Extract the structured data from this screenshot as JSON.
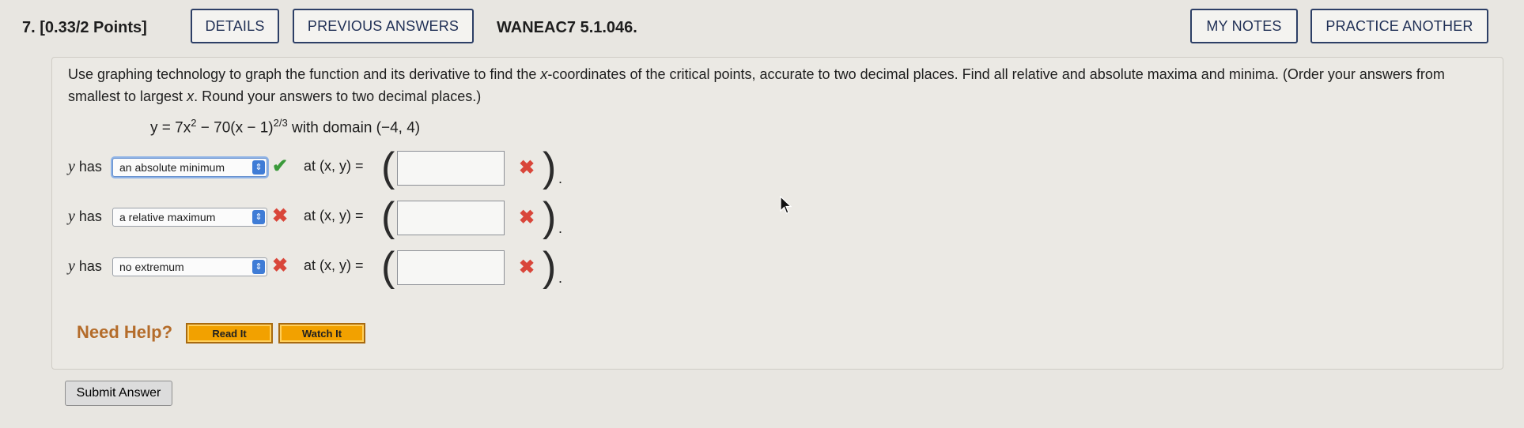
{
  "header": {
    "question_number": "7. [0.33/2 Points]",
    "details_label": "DETAILS",
    "previous_answers_label": "PREVIOUS ANSWERS",
    "question_id": "WANEAC7 5.1.046.",
    "my_notes_label": "MY NOTES",
    "practice_another_label": "PRACTICE ANOTHER"
  },
  "question": {
    "instructions_part1": "Use graphing technology to graph the function and its derivative to find the ",
    "instructions_x1": "x",
    "instructions_part2": "-coordinates of the critical points, accurate to two decimal places. Find all relative and absolute maxima and minima. (Order your answers from smallest to largest ",
    "instructions_x2": "x",
    "instructions_part3": ". Round your answers to two decimal places.)",
    "formula": {
      "lhs": "y = 7x",
      "exp1": "2",
      "mid": " − 70(x − 1)",
      "exp2": "2/3",
      "rest": " with domain (−4, 4)"
    }
  },
  "rows": [
    {
      "prefix": "has",
      "selected": "an absolute minimum",
      "status": "correct",
      "at_label": "at (x, y) =",
      "answer": ""
    },
    {
      "prefix": "has",
      "selected": "a relative maximum",
      "status": "incorrect",
      "at_label": "at (x, y) =",
      "answer": ""
    },
    {
      "prefix": "has",
      "selected": "no extremum",
      "status": "incorrect",
      "at_label": "at (x, y) =",
      "answer": ""
    }
  ],
  "icons": {
    "correct": "✔",
    "incorrect": "✖",
    "select_arrow": "⇕"
  },
  "help": {
    "title": "Need Help?",
    "read_it": "Read It",
    "watch_it": "Watch It"
  },
  "submit_label": "Submit Answer",
  "colors": {
    "correct": "#3a9a3a",
    "incorrect": "#d9463a",
    "help_button": "#f2a100",
    "select_arrow": "#3f7cd6"
  }
}
